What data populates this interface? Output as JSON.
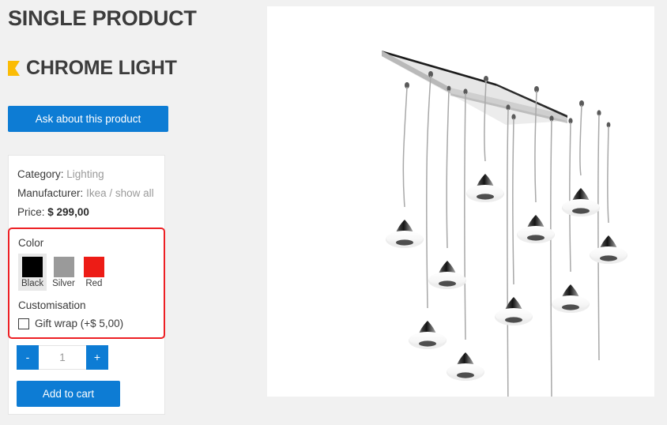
{
  "page": {
    "title": "SINGLE PRODUCT",
    "background_color": "#f1f1f1"
  },
  "product": {
    "name": "CHROME LIGHT",
    "bullet_icon": "flag-bullet-icon",
    "bullet_color": "#fbbc05",
    "ask_button_label": "Ask about this product",
    "accent_color": "#0d7cd4"
  },
  "details": {
    "category_label": "Category:",
    "category_value": "Lighting",
    "manufacturer_label": "Manufacturer:",
    "manufacturer_value": "Ikea",
    "manufacturer_separator": "/",
    "manufacturer_show_all": "show all",
    "price_label": "Price:",
    "price_value": "$ 299,00"
  },
  "options": {
    "highlight_color": "#ed2024",
    "color_heading": "Color",
    "colors": [
      {
        "label": "Black",
        "hex": "#000000",
        "selected": true
      },
      {
        "label": "Silver",
        "hex": "#9a9a9a",
        "selected": false
      },
      {
        "label": "Red",
        "hex": "#ed1c16",
        "selected": false
      }
    ],
    "customisation_heading": "Customisation",
    "gift_wrap_label": "Gift wrap (+$ 5,00)",
    "gift_wrap_checked": false
  },
  "cart": {
    "decrement_label": "-",
    "increment_label": "+",
    "quantity_value": "1",
    "quantity_placeholder": "1",
    "add_to_cart_label": "Add to cart"
  },
  "image": {
    "alt": "Chrome multi-pendant ceiling light with ten teardrop lamps",
    "background": "#ffffff"
  }
}
